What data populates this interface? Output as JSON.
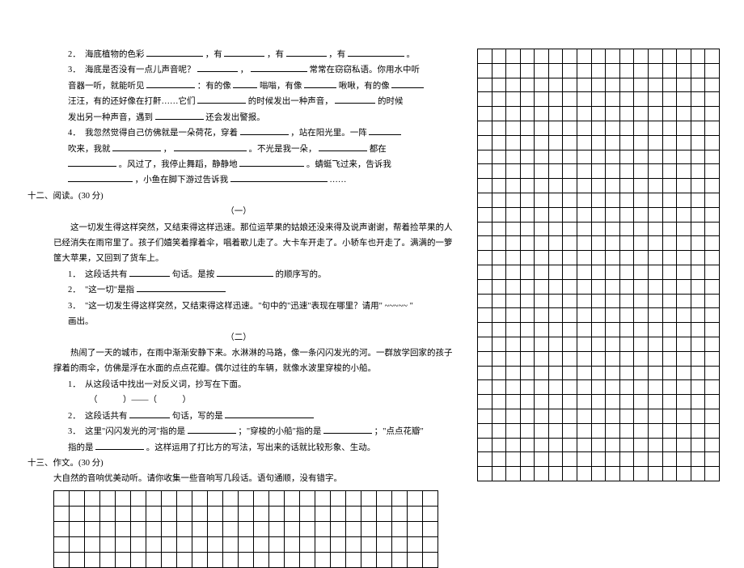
{
  "q2": {
    "prefix": "2．　海底植物的色彩",
    "c1": "，有",
    "c2": "，有",
    "c3": "，有",
    "suffix": "。"
  },
  "q3": {
    "l1a": "3．　海底是否没有一点儿声音呢？",
    "l1b": "，",
    "l1c": "常常在窃窃私语。你用水中听",
    "l2a": "音器一听，就能听见",
    "l2b": "：有的像",
    "l2c": "嗡嗡，有像",
    "l2d": "啾啾，有的像",
    "l2e": "",
    "l3a": "汪汪，有的还好像在打鼾……它们",
    "l3b": "的时候发出一种声音，",
    "l3c": "的时候",
    "l4a": "发出另一种声音，遇到",
    "l4b": "还会发出警报。"
  },
  "q4": {
    "l1a": "4．　我忽然觉得自己仿佛就是一朵荷花，穿着",
    "l1b": "，站在阳光里。一阵",
    "l2a": "吹来，我就",
    "l2b": "，",
    "l2c": "。不光是我一朵，",
    "l2d": "都在",
    "l3a": "。风过了，我停止舞蹈，静静地",
    "l3b": "。蜻蜓飞过来，告诉我",
    "l4a": "，小鱼在脚下游过告诉我",
    "l4b": "……"
  },
  "s12": {
    "title": "十二、阅读。(30 分)",
    "sub1": "（一）",
    "p1": "这一切发生得这样突然，又结束得这样迅速。那位运苹果的姑娘还没来得及说声谢谢，帮着捡苹果的人已经消失在雨帘里了。孩子们嬉笑着撑着伞，唱着歌儿走了。大卡车开走了。小轿车也开走了。满满的一箩筐大苹果，又回到了货车上。",
    "q1a": "1．　这段话共有",
    "q1b": "句话。是按",
    "q1c": "的顺序写的。",
    "q2": "2．　\"这一切\"是指",
    "q3a": "3．　\"这一切发生得这样突然，又结束得这样迅速。\"句中的\"迅速\"表现在哪里？请用\"",
    "q3b": "\"",
    "q3c": "画出。",
    "sub2": "（二）",
    "p2": "热闹了一天的城市，在雨中渐渐安静下来。水淋淋的马路，像一条闪闪发光的河。一群放学回家的孩子撑着的雨伞，仿佛是浮在水面的点点花瓣。偶尔过往的车辆，就像水波里穿梭的小船。",
    "q21": "1．　从这段话中找出一对反义词，抄写在下面。",
    "q21b": "（　　　）——（　　　）",
    "q22a": "2．　这段话共有",
    "q22b": "句话，写的是",
    "q23a": "3．　这里\"闪闪发光的河\"指的是",
    "q23b": "；\"穿梭的小船\"指的是",
    "q23c": "；\"点点花瓣\"",
    "q23d": "指的是",
    "q23e": "。这样运用了打比方的写法，写出来的话就比较形象、生动。"
  },
  "s13": {
    "title": "十三、作文。(30 分)",
    "prompt": "大自然的音响优美动听。请你收集一些音响写几段话。语句通顺，没有错字。"
  },
  "wavy": "~~~~~",
  "grid": {
    "smallRows": 5,
    "smallCols": 25,
    "bigRows": 30,
    "bigCols": 17
  }
}
